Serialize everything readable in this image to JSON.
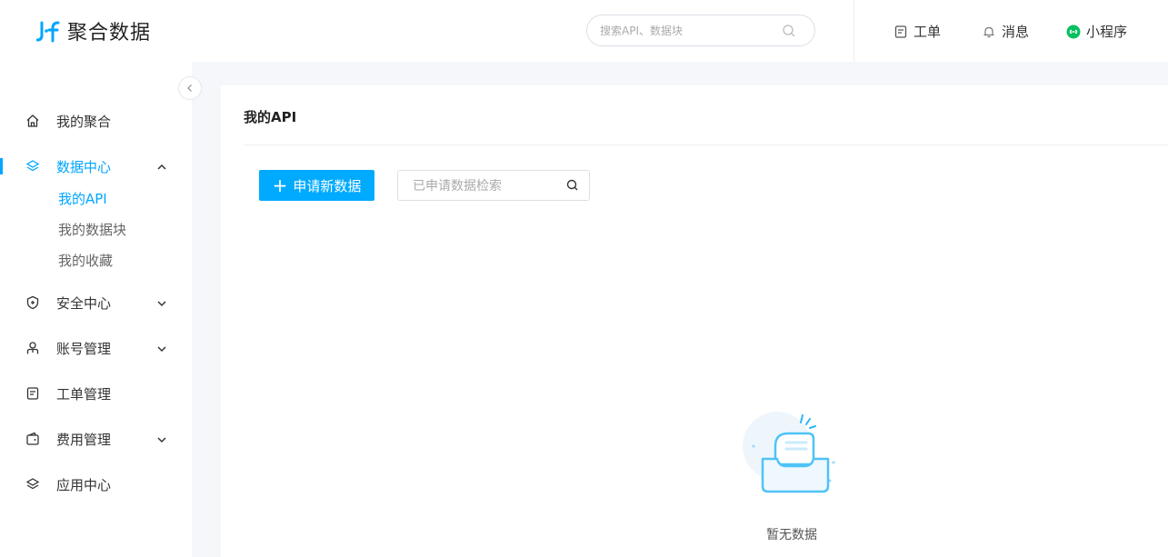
{
  "brand": {
    "name": "聚合数据",
    "accent": "#00a6ff"
  },
  "header": {
    "search_placeholder": "搜索API、数据块",
    "ticket_label": "工单",
    "message_label": "消息",
    "miniprogram_label": "小程序"
  },
  "sidebar": {
    "items": [
      {
        "label": "我的聚合",
        "icon": "home-icon"
      },
      {
        "label": "数据中心",
        "icon": "layers-icon",
        "expanded": true,
        "children": [
          {
            "label": "我的API"
          },
          {
            "label": "我的数据块"
          },
          {
            "label": "我的收藏"
          }
        ]
      },
      {
        "label": "安全中心",
        "icon": "shield-icon"
      },
      {
        "label": "账号管理",
        "icon": "user-icon"
      },
      {
        "label": "工单管理",
        "icon": "ticket-icon"
      },
      {
        "label": "费用管理",
        "icon": "wallet-icon"
      },
      {
        "label": "应用中心",
        "icon": "layers-icon"
      }
    ]
  },
  "main": {
    "title": "我的API",
    "apply_button": "申请新数据",
    "filter_placeholder": "已申请数据检索",
    "empty_text": "暂无数据"
  }
}
